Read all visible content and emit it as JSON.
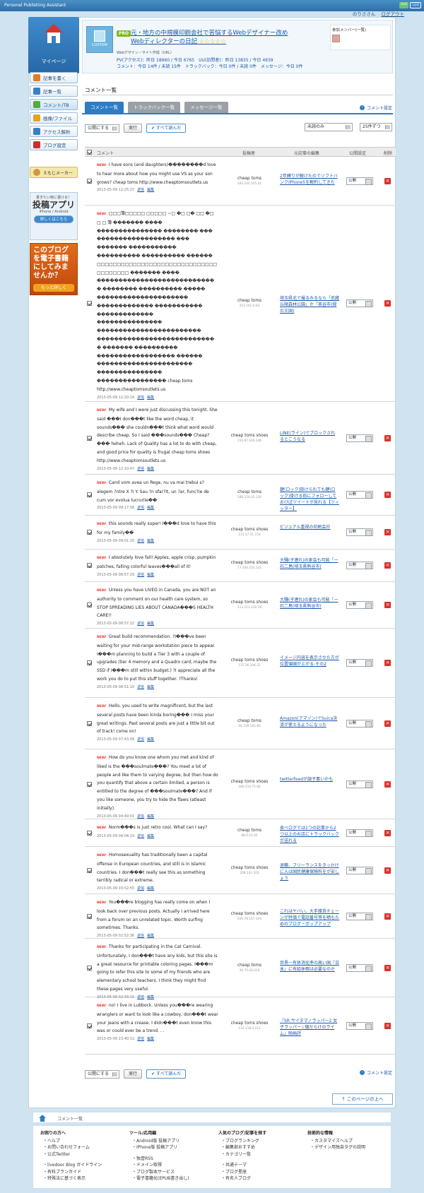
{
  "app": {
    "brand": "Personal Publishing Assistant",
    "badges": [
      "OLO",
      "LGO"
    ],
    "user": "のりささん",
    "logout": "ログアウト"
  },
  "sidebar": {
    "mypage": "マイページ",
    "items": [
      "記事を書く",
      "記事一覧",
      "コメント/TB",
      "画像/ファイル",
      "アクセス解析",
      "ブログ設定"
    ],
    "ebisu": "えもじメーカー",
    "promo1": {
      "t1": "書きたい時に書ける！",
      "t2": "投稿アプリ",
      "t3": "iPhone / Android",
      "btn": "詳しくはこちら"
    },
    "promo2": {
      "t": "このブログを電子書籍にしてみませんか？",
      "more": "もっと詳しく"
    }
  },
  "blog": {
    "icon": "CUSTOM",
    "pro": "PRO",
    "title": "元・地方の中規模印刷会社で苦悩するWebデザイナー改めWebディレクターの日記",
    "stars": "☆☆☆☆☆",
    "sub": "Webデザイン・サイト作成（URL）",
    "stats1": "PV(アクセス)：昨日 18960 / 今日 6765　UU(訪問者)：昨日 13835 / 今日 4939",
    "stats2": "コメント：今日 14件 / 未読 15件　トラックバック：今日 0件 / 未読 0件　メッセージ：今日 0件",
    "members": "参加メンバー(一覧)"
  },
  "page": {
    "title": "コメント一覧",
    "tabs": [
      "コメント一覧",
      "トラックバック一覧",
      "メッセージ一覧"
    ],
    "settings": "コメント設定",
    "publish_sel": "公開にする",
    "exec": "実行",
    "read_all": "すべて読んだ",
    "filter": "未読のみ",
    "perpage": "25件ずつ",
    "cols": [
      "コメント",
      "投稿者",
      "元記事の編集",
      "公開設定",
      "削除"
    ],
    "reply": "返信",
    "edit": "編集",
    "status": "公開",
    "new": "NEW!"
  },
  "comments": [
    {
      "text": "I have sons (and daughters)��������d love to hear more about how you might use VS as your son grows? cheap toms http://www.cheaptomsoutlets.us",
      "date": "2013-05-09 12:25:37",
      "poster": "cheap toms",
      "ip": "183.240.105.31",
      "src": "2年縛りが解けたのでソフトバンクiPhone5を解約してきた"
    },
    {
      "text": "□□□簿□□□□□ □□□□□ ~□ �□ □� □□ �□ □ □ 簿 ������� ���� ��������������� �������� ��� ������������������ ��� ������� ����������� ���������� ���������� ������ □□□□□□□□□□□□□□□□□□□□□□□□□□□□□□□□□□□□□□ ������� ���� ���������������������������� �������� ���������� ����� ��������������������� ������������� ����������� ������������� ��������������� ������������������������ ���������������������������� ������� ���������� ������������������ ������ ���������������������� ��������������� ���������������� cheap toms http://www.cheaptomsoutlets.us",
      "date": "2013-05-09 12:20:14",
      "poster": "cheap toms",
      "ip": "203.161.0.83",
      "src": "埼玉県北で撮るみるなら「武蔵丘陵森林公園」か「茶谷市(緑の王国)"
    },
    {
      "text": "My wife and I were just discussing this tonight. She said ���I don���t like the word cheap, it sounds��� she couldn���t think what word would describe cheap. So I said ���sounds��� Cheap?��� heheh. Lack of Quality has a lot to do with cheap, and good price for quality is frugal cheap toms shoes http://www.cheaptomsoutlets.us",
      "date": "2013-05-09 12:10:47",
      "poster": "cheap toms shoes",
      "ip": "110.87.100.246",
      "src": "LINE(ライン)でブロックされるとこうなる"
    },
    {
      "text": "Cand vom avea un Rege, nu va mai trebui s? alegem ?ntre X ?i Y. Sau ?n sfar?it, un ?ar, func?ie de cum vor evolua lucrurile��",
      "date": "2013-05-09 09:17:56",
      "poster": "cheap toms",
      "ip": "188.216.32.130",
      "src": "鍵(ロック)掛けられても鍵(ロック)掛ける前にフォローしておけばツイートが見れる【ツィッター】"
    },
    {
      "text": "this sounds really super! I���d love to have this for my family��",
      "date": "2013-05-09 09:01:20",
      "poster": "cheap toms shoes",
      "ip": "115.57.51.154",
      "src": "ビジュアル重視の印刷会社"
    },
    {
      "text": "I absolutely love fall! Apples, apple crisp, pumpkin patches, falling colorful leaves���all of it!",
      "date": "2013-05-09 08:57:29",
      "poster": "cheap toms shoes",
      "ip": "77.240.233.121",
      "src": "大騒(子連れ)の家会も可能「一石二鳥(埼玉県熊谷市)"
    },
    {
      "text": "Unless you have LIVED in Canada, you are NOT an authority to comment on our health care system, so STOP SPREADING LIES ABOUT CANADA���S HEALTH CARE!!",
      "date": "2013-05-09 08:57:22",
      "poster": "cheap toms shoes",
      "ip": "113.212.232.28",
      "src": "大騒(子連れ)の家会も可能「一石二鳥(埼玉県熊谷市)"
    },
    {
      "text": "Great build recommendation. ?I���ve been waiting for your mid-range workstation piece to appear. I���m planning to build a Tier 3 with a couple of upgrades (tier 4 memory and a Quadro card, maybe the SSD if I���m still within budget.) ?I appreciate all the work you do to put this stuff together. ?Thanks!",
      "date": "2013-05-09 08:51:10",
      "poster": "cheap toms shoes",
      "ip": "115.36.206.31",
      "src": "イメージ内容を表示させた方が位置値順が上がる-その2"
    },
    {
      "text": "Hello, you used to write magnificent, but the last several posts have been kinda boring��� I miss your great writings. Past several posts are just a little bit out of track! come on!",
      "date": "2013-05-09 07:43:09",
      "poster": "cheap toms",
      "ip": "46.139.182.86",
      "src": "Amazon(アマゾン)でSuica決済が使えるようになった"
    },
    {
      "text": "How do you know one whom you met and kind of liked is the ���soulmate���? You meet a lot of people and like them to varying degree, but then how do you quantify that above a certain limited, a person is entitled to the degree of ���soulmate���? And if you like someone, you try to hide the flaws (atleast initially).",
      "date": "2013-05-09 04:49:01",
      "poster": "cheap toms shoes",
      "ip": "180.250.75.84",
      "src": "twitterfeedが調子悪いかも"
    },
    {
      "text": "Norm���s is just retro cool. What can I say?",
      "date": "2013-05-09 04:04:19",
      "poster": "cheap toms",
      "ip": "88.0.25.40",
      "src": "食べログでは1つの記事から2つ以上のお店にトラックバックが送れる"
    },
    {
      "text": "Homosexuality has traditionally been a capital offense in European countries, and still is in Islamic countries. I don���t really see this as something terribly radical or extreme.",
      "date": "2013-05-09 03:52:55",
      "poster": "cheap toms shoes",
      "ip": "208.242.203",
      "src": "退職、フリーランスをきっかけに入は国民健康保険料をが安しょう"
    },
    {
      "text": "You���re blogging has really come on when I look back over previous posts. Actually I arrived here from a forum on an unrelated topic. Worth surfing sometimes. Thanks.",
      "date": "2013-05-09 02:52:36",
      "poster": "cheap toms shoes",
      "ip": "200.78.167.194",
      "src": "これはヤバい。大手雑貨チェーンが特価で電話番号等を晒もためのブログ・ポップアップ"
    },
    {
      "text": "Thanks for participating in the Cat Carnival. Unfortunately, I don���t have any kids, but this site is a great resource for printable coloring pages. I���m going to refer this site to some of my friends who are elementary school teachers. I think they might find these pages very useful.",
      "date": "2013-05-09 02:33:15",
      "poster": "cheap toms",
      "ip": "36.70.26.016",
      "src": "世界一有休消化率の高い国『日本』に有給休暇は必要なのか"
    },
    {
      "text": "no! I live in Lubbock. Unless you���re wearing wranglers or want to look like a cowboy, don���t wear your jeans with a crease. I didn���t even know this was or could ever be a trend. . .",
      "date": "2013-05-09 23:40:11",
      "poster": "cheap toms shoes",
      "ip": "110.118.4.212",
      "src": "『SR サイタマノラッパー2 女子ラッパー☆傷だらけのライム』映画評"
    }
  ],
  "footer": {
    "crumb": "コメント一覧",
    "toplink": "このページの上へ",
    "cols": [
      {
        "h": "お困りの方へ",
        "items": [
          "ヘルプ",
          "お問い合わせフォーム",
          "公式Twitter",
          "",
          "livedoor Blog ガイドライン",
          "有料ブランガイド",
          "特殊法に基づく表示"
        ]
      },
      {
        "h": "ツール/応用編",
        "items": [
          "Android版 投稿アプリ",
          "iPhone版 投稿アプリ",
          "",
          "独習RSS",
          "ドメイン取得",
          "ブログ製本サービス",
          "電子書籍化(EPUB書き出し)"
        ]
      },
      {
        "h": "人気のブログ/記事を探す",
        "items": [
          "ブログランキング",
          "編集部おすすめ",
          "カテゴリ一覧",
          "",
          "共通テーマ",
          "ブログ星座",
          "有名人ブログ"
        ]
      },
      {
        "h": "技術的な情報",
        "items": [
          "カスタマイズヘルプ",
          "デザイン用独自タグの説明"
        ]
      }
    ]
  },
  "colors": {
    "accent": "#2e7cc4",
    "delete": "#d8322b",
    "new": "#e33333",
    "bg": "#cfe3f1"
  }
}
